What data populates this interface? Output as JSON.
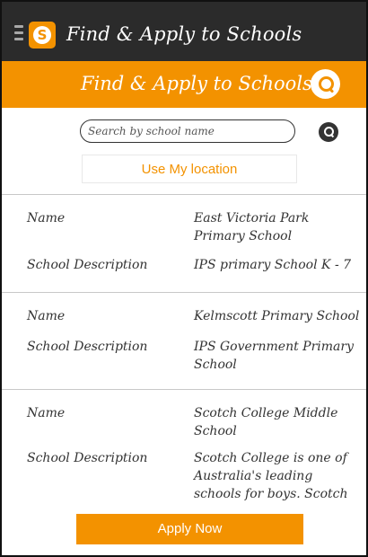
{
  "app_bar": {
    "title": "Find & Apply to Schools",
    "logo_letter": "S",
    "logo_color": "#f39200",
    "background_color": "#2b2b2b",
    "menu_icon": "hamburger-icon"
  },
  "header": {
    "title": "Find & Apply to Schools",
    "background_color": "#f39200",
    "search_icon": "search-icon"
  },
  "search": {
    "placeholder": "Search by school name",
    "button_icon": "search-icon"
  },
  "location_button": "Use My location",
  "labels": {
    "name": "Name",
    "description": "School Description"
  },
  "schools": [
    {
      "name": "East Victoria Park Primary School",
      "description": "IPS primary School K - 7"
    },
    {
      "name": "Kelmscott Primary School",
      "description": "IPS Government Primary School"
    },
    {
      "name": "Scotch College Middle School",
      "description": "Scotch College is one of Australia's leading schools for boys. Scotch"
    }
  ],
  "apply_button": "Apply Now"
}
